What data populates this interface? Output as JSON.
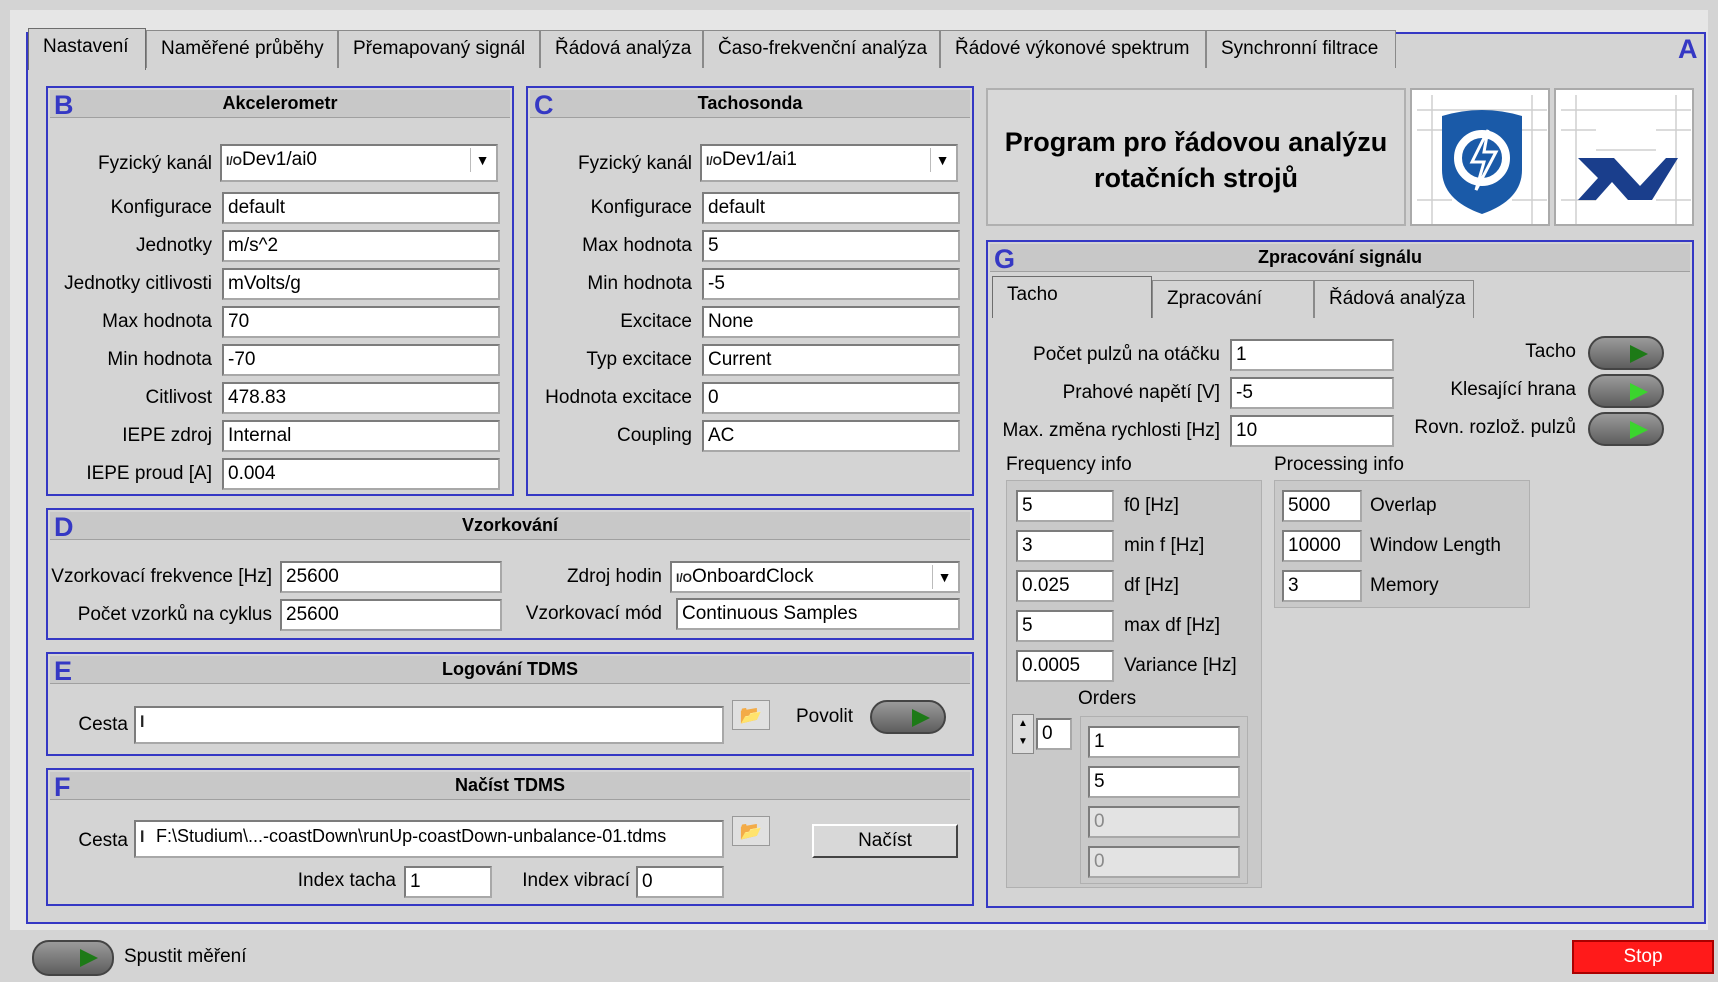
{
  "tabs": [
    "Nastavení",
    "Naměřené průběhy",
    "Přemapovaný signál",
    "Řádová analýza",
    "Časo-frekvenční analýza",
    "Řádové výkonové spektrum",
    "Synchronní filtrace"
  ],
  "section_letters": {
    "a": "A",
    "b": "B",
    "c": "C",
    "d": "D",
    "e": "E",
    "f": "F",
    "g": "G"
  },
  "accelerometer": {
    "title": "Akcelerometr",
    "labels": [
      "Fyzický kanál",
      "Konfigurace",
      "Jednotky",
      "Jednotky citlivosti",
      "Max hodnota",
      "Min hodnota",
      "Citlivost",
      "IEPE zdroj",
      "IEPE proud [A]"
    ],
    "values": [
      "Dev1/ai0",
      "default",
      "m/s^2",
      "mVolts/g",
      "70",
      "-70",
      "478.83",
      "Internal",
      "0.004"
    ]
  },
  "tacho_probe": {
    "title": "Tachosonda",
    "labels": [
      "Fyzický kanál",
      "Konfigurace",
      "Max hodnota",
      "Min hodnota",
      "Excitace",
      "Typ excitace",
      "Hodnota excitace",
      "Coupling"
    ],
    "values": [
      "Dev1/ai1",
      "default",
      "5",
      "-5",
      "None",
      "Current",
      "0",
      "AC"
    ]
  },
  "sampling": {
    "title": "Vzorkování",
    "rate_label": "Vzorkovací frekvence [Hz]",
    "rate_value": "25600",
    "samples_label": "Počet vzorků na cyklus",
    "samples_value": "25600",
    "clock_label": "Zdroj hodin",
    "clock_value": "OnboardClock",
    "mode_label": "Vzorkovací mód",
    "mode_value": "Continuous Samples"
  },
  "tdms_log": {
    "title": "Logování TDMS",
    "path_label": "Cesta",
    "path_value": "",
    "enable_label": "Povolit"
  },
  "tdms_load": {
    "title": "Načíst TDMS",
    "path_label": "Cesta",
    "path_value": "F:\\Studium\\...-coastDown\\runUp-coastDown-unbalance-01.tdms",
    "load_button": "Načíst",
    "tacho_index_label": "Index tacha",
    "tacho_index_value": "1",
    "vib_index_label": "Index vibrací",
    "vib_index_value": "0"
  },
  "program_title_line1": "Program pro řádovou analýzu",
  "program_title_line2": "rotačních strojů",
  "processing": {
    "title": "Zpracování signálu",
    "tabs": [
      "Tacho",
      "Zpracování",
      "Řádová analýza"
    ],
    "pulses_label": "Počet pulzů na otáčku",
    "pulses_value": "1",
    "threshold_label": "Prahové napětí [V]",
    "threshold_value": "-5",
    "maxchange_label": "Max. změna rychlosti [Hz]",
    "maxchange_value": "10",
    "led_labels": [
      "Tacho",
      "Klesající hrana",
      "Rovn. rozlož. pulzů"
    ],
    "freq_title": "Frequency info",
    "freq_values": [
      "5",
      "3",
      "0.025",
      "5",
      "0.0005"
    ],
    "freq_labels": [
      "f0 [Hz]",
      "min f [Hz]",
      "df [Hz]",
      "max df [Hz]",
      "Variance [Hz]"
    ],
    "orders_title": "Orders",
    "orders_index": "0",
    "orders_values": [
      "1",
      "5",
      "0",
      "0"
    ],
    "proc_title": "Processing info",
    "proc_values": [
      "5000",
      "10000",
      "3"
    ],
    "proc_labels": [
      "Overlap",
      "Window Length",
      "Memory"
    ]
  },
  "run_label": "Spustit měření",
  "stop_label": "Stop",
  "colors": {
    "accent": "#3538c4",
    "stop": "#ff1a1a",
    "led_on": "#3bd42e"
  }
}
